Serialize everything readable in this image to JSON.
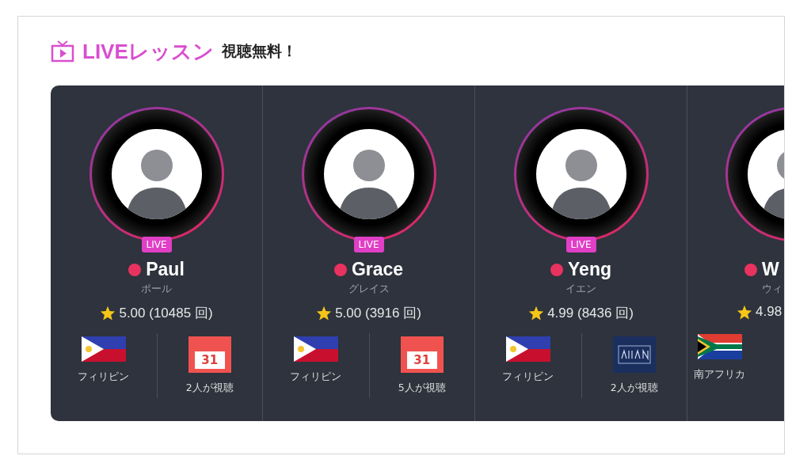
{
  "header": {
    "title": "LIVEレッスン",
    "subtitle": "視聴無料！"
  },
  "teachers": [
    {
      "badge": "LIVE",
      "online": true,
      "name": "Paul",
      "kana": "ポール",
      "rating": "5.00 (10485 回)",
      "country": "フィリピン",
      "flag": {
        "kind": "philippines"
      },
      "stat": {
        "kind": "calendar",
        "day": "31",
        "label": "2人が視聴"
      }
    },
    {
      "badge": "LIVE",
      "online": true,
      "name": "Grace",
      "kana": "グレイス",
      "rating": "5.00 (3916 回)",
      "country": "フィリピン",
      "flag": {
        "kind": "philippines"
      },
      "stat": {
        "kind": "calendar",
        "day": "31",
        "label": "5人が視聴"
      }
    },
    {
      "badge": "LIVE",
      "online": true,
      "name": "Yeng",
      "kana": "イエン",
      "rating": "4.99 (8436 回)",
      "country": "フィリピン",
      "flag": {
        "kind": "philippines"
      },
      "stat": {
        "kind": "logo",
        "label": "2人が視聴"
      }
    },
    {
      "online": true,
      "name": "W",
      "kana": "ウィ",
      "rating": "4.98",
      "country": "南アフリカ",
      "flag": {
        "kind": "south_africa"
      }
    }
  ]
}
